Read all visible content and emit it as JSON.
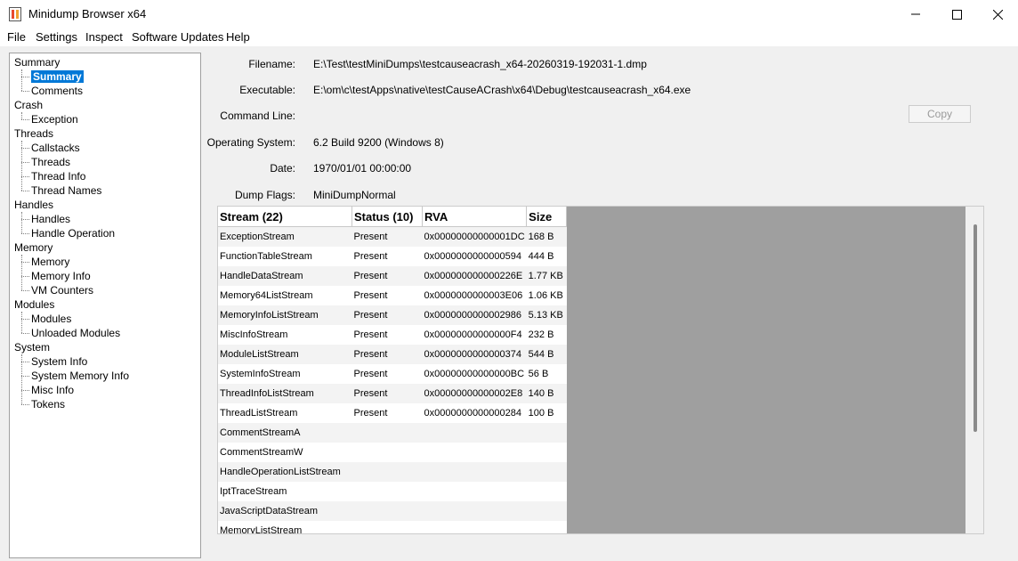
{
  "window": {
    "title": "Minidump Browser x64"
  },
  "menu": [
    "File",
    "Settings",
    "Inspect",
    "Software Updates",
    "Help"
  ],
  "tree": [
    {
      "label": "Summary",
      "children": [
        {
          "label": "Summary",
          "selected": true
        },
        {
          "label": "Comments"
        }
      ]
    },
    {
      "label": "Crash",
      "children": [
        {
          "label": "Exception"
        }
      ]
    },
    {
      "label": "Threads",
      "children": [
        {
          "label": "Callstacks"
        },
        {
          "label": "Threads"
        },
        {
          "label": "Thread Info"
        },
        {
          "label": "Thread Names"
        }
      ]
    },
    {
      "label": "Handles",
      "children": [
        {
          "label": "Handles"
        },
        {
          "label": "Handle Operation"
        }
      ]
    },
    {
      "label": "Memory",
      "children": [
        {
          "label": "Memory"
        },
        {
          "label": "Memory Info"
        },
        {
          "label": "VM Counters"
        }
      ]
    },
    {
      "label": "Modules",
      "children": [
        {
          "label": "Modules"
        },
        {
          "label": "Unloaded Modules"
        }
      ]
    },
    {
      "label": "System",
      "children": [
        {
          "label": "System Info"
        },
        {
          "label": "System Memory Info"
        },
        {
          "label": "Misc Info"
        },
        {
          "label": "Tokens"
        }
      ]
    }
  ],
  "details": [
    {
      "label": "Filename:",
      "value": "E:\\Test\\testMiniDumps\\testcauseacrash_x64-20260319-192031-1.dmp"
    },
    {
      "label": "Executable:",
      "value": "E:\\om\\c\\testApps\\native\\testCauseACrash\\x64\\Debug\\testcauseacrash_x64.exe"
    },
    {
      "label": "Command Line:",
      "value": ""
    },
    {
      "label": "Operating System:",
      "value": "6.2 Build 9200 (Windows 8)"
    },
    {
      "label": "Date:",
      "value": "1970/01/01 00:00:00"
    },
    {
      "label": "Dump Flags:",
      "value": "MiniDumpNormal"
    }
  ],
  "copy_button": "Copy",
  "grid": {
    "columns": [
      "Stream (22)",
      "Status (10)",
      "RVA",
      "Size"
    ],
    "rows": [
      [
        "ExceptionStream",
        "Present",
        "0x00000000000001DC",
        "168 B"
      ],
      [
        "FunctionTableStream",
        "Present",
        "0x0000000000000594",
        "444 B"
      ],
      [
        "HandleDataStream",
        "Present",
        "0x000000000000226E",
        "1.77 KB"
      ],
      [
        "Memory64ListStream",
        "Present",
        "0x0000000000003E06",
        "1.06 KB"
      ],
      [
        "MemoryInfoListStream",
        "Present",
        "0x0000000000002986",
        "5.13 KB"
      ],
      [
        "MiscInfoStream",
        "Present",
        "0x00000000000000F4",
        "232 B"
      ],
      [
        "ModuleListStream",
        "Present",
        "0x0000000000000374",
        "544 B"
      ],
      [
        "SystemInfoStream",
        "Present",
        "0x00000000000000BC",
        "56 B"
      ],
      [
        "ThreadInfoListStream",
        "Present",
        "0x00000000000002E8",
        "140 B"
      ],
      [
        "ThreadListStream",
        "Present",
        "0x0000000000000284",
        "100 B"
      ],
      [
        "CommentStreamA",
        "",
        "",
        ""
      ],
      [
        "CommentStreamW",
        "",
        "",
        ""
      ],
      [
        "HandleOperationListStream",
        "",
        "",
        ""
      ],
      [
        "IptTraceStream",
        "",
        "",
        ""
      ],
      [
        "JavaScriptDataStream",
        "",
        "",
        ""
      ],
      [
        "MemoryListStream",
        "",
        "",
        ""
      ]
    ]
  }
}
